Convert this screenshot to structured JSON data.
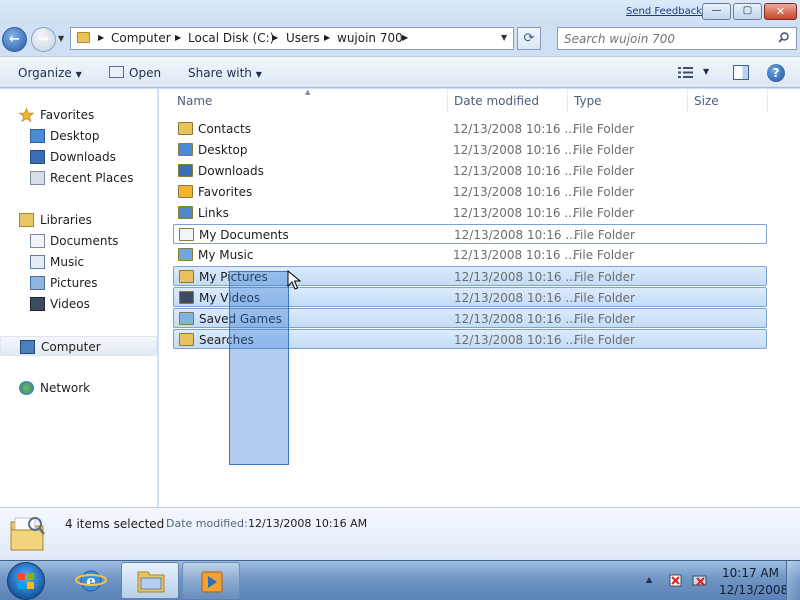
{
  "titlebar": {
    "send_feedback": "Send Feedback",
    "minimize_glyph": "—",
    "maximize_glyph": "▢",
    "close_glyph": "✕"
  },
  "address": {
    "back_glyph": "←",
    "forward_glyph": "→",
    "crumbs": [
      "Computer",
      "Local Disk (C:)",
      "Users",
      "wujoin 700"
    ],
    "refresh_glyph": "⟳"
  },
  "search": {
    "placeholder": "Search wujoin 700"
  },
  "toolbar": {
    "organize": "Organize",
    "open": "Open",
    "share_with": "Share with",
    "help_glyph": "?"
  },
  "nav": {
    "favorites": "Favorites",
    "desktop": "Desktop",
    "downloads": "Downloads",
    "recent_places": "Recent Places",
    "libraries": "Libraries",
    "documents": "Documents",
    "music": "Music",
    "pictures": "Pictures",
    "videos": "Videos",
    "computer": "Computer",
    "network": "Network"
  },
  "columns": {
    "name": "Name",
    "date_modified": "Date modified",
    "type": "Type",
    "size": "Size"
  },
  "files": [
    {
      "name": "Contacts",
      "date": "12/13/2008 10:16 ...",
      "type": "File Folder",
      "icon": "contacts-folder-icon",
      "state": "normal"
    },
    {
      "name": "Desktop",
      "date": "12/13/2008 10:16 ...",
      "type": "File Folder",
      "icon": "desktop-folder-icon",
      "state": "normal"
    },
    {
      "name": "Downloads",
      "date": "12/13/2008 10:16 ...",
      "type": "File Folder",
      "icon": "downloads-folder-icon",
      "state": "normal"
    },
    {
      "name": "Favorites",
      "date": "12/13/2008 10:16 ...",
      "type": "File Folder",
      "icon": "favorites-folder-icon",
      "state": "normal"
    },
    {
      "name": "Links",
      "date": "12/13/2008 10:16 ...",
      "type": "File Folder",
      "icon": "links-folder-icon",
      "state": "normal"
    },
    {
      "name": "My Documents",
      "date": "12/13/2008 10:16 ...",
      "type": "File Folder",
      "icon": "documents-folder-icon",
      "state": "focus"
    },
    {
      "name": "My Music",
      "date": "12/13/2008 10:16 ...",
      "type": "File Folder",
      "icon": "music-folder-icon",
      "state": "normal"
    },
    {
      "name": "My Pictures",
      "date": "12/13/2008 10:16 ...",
      "type": "File Folder",
      "icon": "pictures-folder-icon",
      "state": "selected"
    },
    {
      "name": "My Videos",
      "date": "12/13/2008 10:16 ...",
      "type": "File Folder",
      "icon": "videos-folder-icon",
      "state": "selected"
    },
    {
      "name": "Saved Games",
      "date": "12/13/2008 10:16 ...",
      "type": "File Folder",
      "icon": "saved-games-folder-icon",
      "state": "selected"
    },
    {
      "name": "Searches",
      "date": "12/13/2008 10:16 ...",
      "type": "File Folder",
      "icon": "searches-folder-icon",
      "state": "selected"
    }
  ],
  "details": {
    "selection": "4 items selected",
    "date_label": "Date modified:",
    "date_value": "12/13/2008 10:16 AM"
  },
  "taskbar": {
    "time": "10:17 AM",
    "date": "12/13/2008"
  },
  "colors": {
    "selection_fill": "#c3dcf6",
    "selection_border": "#7da2ce",
    "marquee": "#3a78c8",
    "folder_yellow": "#e8c25c"
  }
}
